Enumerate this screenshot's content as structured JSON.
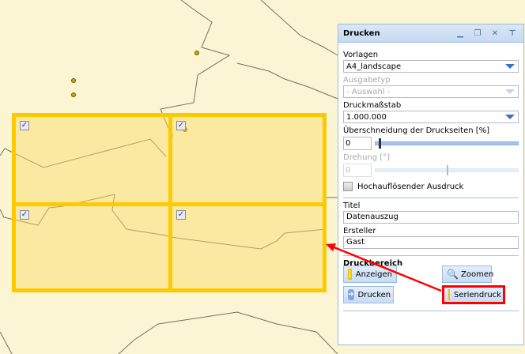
{
  "panel": {
    "title": "Drucken",
    "tools": [
      "minimize-icon",
      "restore-icon",
      "close-icon",
      "pin-icon"
    ],
    "vorlagen_label": "Vorlagen",
    "vorlagen_value": "A4_landscape",
    "ausgabetyp_label": "Ausgabetyp",
    "ausgabetyp_value": "- Auswahl -",
    "massstab_label": "Druckmaßstab",
    "massstab_value": "1.000.000",
    "ueberschneidung_label": "Überschneidung der Druckseiten [%]",
    "ueberschneidung_value": "0",
    "ueberschneidung_slider": 0,
    "drehung_label": "Drehung [°]",
    "drehung_value": "0",
    "drehung_slider": 0.5,
    "hochaufloesend_label": "Hochauflösender Ausdruck",
    "hochaufloesend_checked": false,
    "titel_label": "Titel",
    "titel_value": "Datenauszug",
    "ersteller_label": "Ersteller",
    "ersteller_value": "Gast",
    "druckbereich_label": "Druckbereich",
    "buttons": {
      "anzeigen": "Anzeigen",
      "zoomen": "Zoomen",
      "drucken": "Drucken",
      "seriendruck": "Seriendruck"
    }
  },
  "map": {
    "pages_checked": [
      true,
      true,
      true,
      true
    ]
  },
  "colors": {
    "highlight": "#ff0000",
    "page_border": "#fdca00"
  }
}
